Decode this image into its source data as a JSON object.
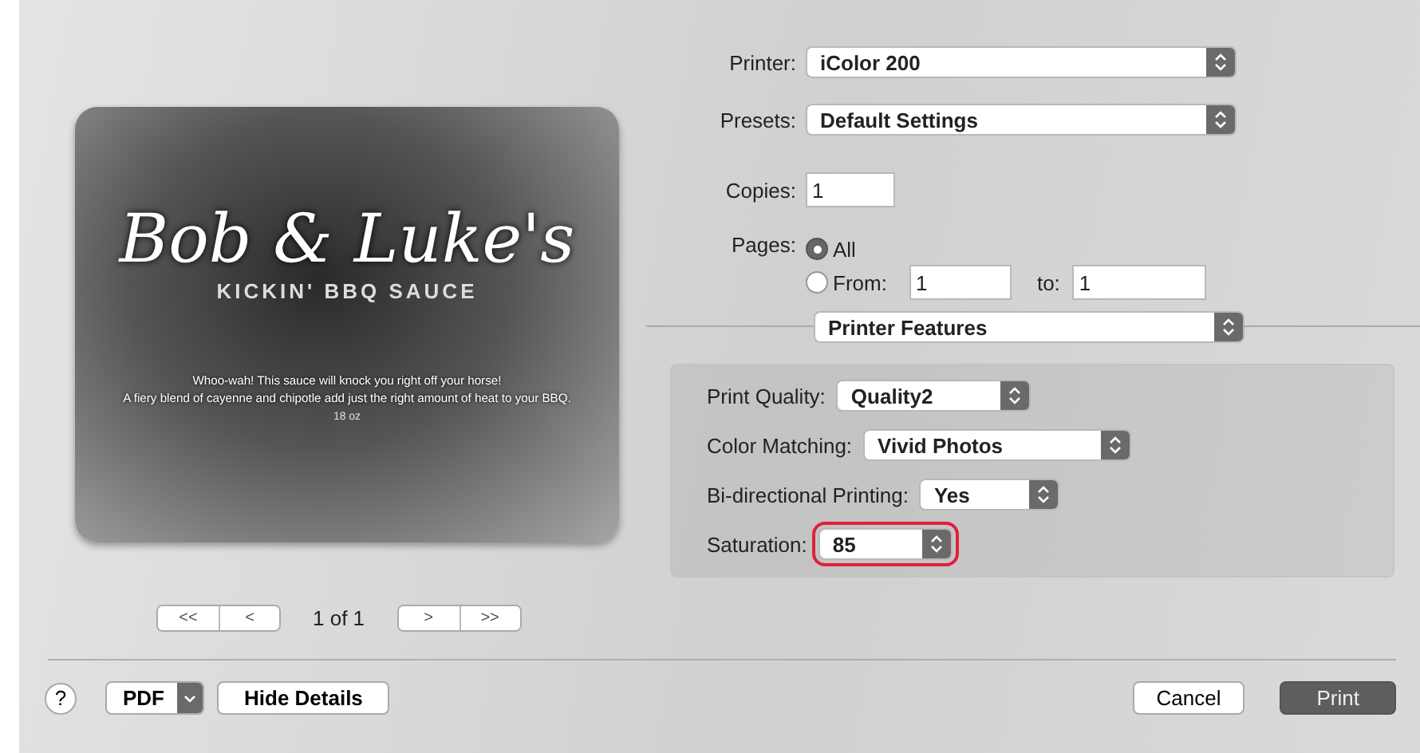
{
  "preview": {
    "title": "Bob & Luke's",
    "subtitle": "KICKIN' BBQ SAUCE",
    "lines": [
      "Whoo-wah! This sauce will knock you right off your horse!",
      "A fiery blend of cayenne and chipotle add just the right amount of heat to your BBQ."
    ],
    "size": "18 oz"
  },
  "pager": {
    "first": "<<",
    "prev": "<",
    "label": "1 of 1",
    "next": ">",
    "last": ">>"
  },
  "printer": {
    "label": "Printer:",
    "value": "iColor 200"
  },
  "presets": {
    "label": "Presets:",
    "value": "Default Settings"
  },
  "copies": {
    "label": "Copies:",
    "value": "1"
  },
  "pages": {
    "label": "Pages:",
    "options": [
      {
        "label": "All",
        "selected": true
      },
      {
        "label": "From:",
        "selected": false
      }
    ],
    "from": "1",
    "to_label": "to:",
    "to": "1"
  },
  "section_menu": {
    "value": "Printer Features"
  },
  "features": [
    {
      "label": "Print Quality:",
      "value": "Quality2",
      "highlighted": false
    },
    {
      "label": "Color Matching:",
      "value": "Vivid Photos",
      "highlighted": false
    },
    {
      "label": "Bi-directional Printing:",
      "value": "Yes",
      "highlighted": false
    },
    {
      "label": "Saturation:",
      "value": "85",
      "highlighted": true
    }
  ],
  "footer": {
    "help": "?",
    "pdf": "PDF",
    "hide_details": "Hide Details",
    "cancel": "Cancel",
    "print": "Print"
  }
}
